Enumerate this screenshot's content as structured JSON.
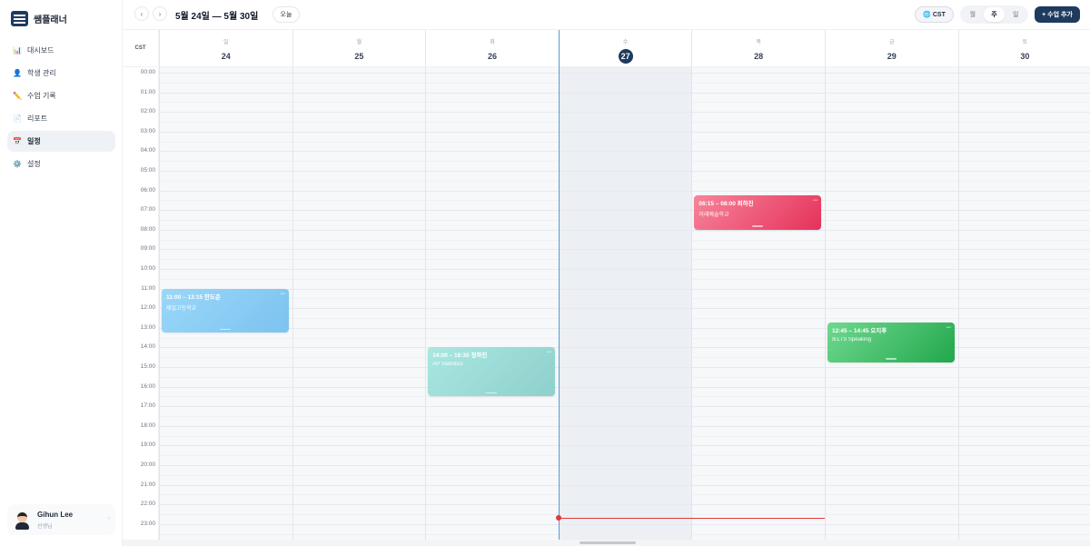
{
  "app": {
    "name": "쌤플래너"
  },
  "sidebar": {
    "items": [
      {
        "label": "대시보드",
        "icon": "📊",
        "icon_name": "bar-chart-icon",
        "active": false
      },
      {
        "label": "학생 관리",
        "icon": "👤",
        "icon_name": "person-icon",
        "active": false
      },
      {
        "label": "수업 기록",
        "icon": "✏️",
        "icon_name": "pencil-icon",
        "active": false
      },
      {
        "label": "리포트",
        "icon": "📄",
        "icon_name": "document-icon",
        "active": false
      },
      {
        "label": "일정",
        "icon": "📅",
        "icon_name": "calendar-icon",
        "active": true
      },
      {
        "label": "설정",
        "icon": "⚙️",
        "icon_name": "gear-icon",
        "active": false
      }
    ],
    "user": {
      "name": "Gihun Lee",
      "role": "선생님"
    }
  },
  "toolbar": {
    "prev_label": "‹",
    "next_label": "›",
    "range": "5월 24일 — 5월 30일",
    "today_label": "오늘",
    "timezone": "CST",
    "views": [
      "월",
      "주",
      "일"
    ],
    "active_view": 1,
    "add_label": "+ 수업 추가"
  },
  "calendar": {
    "timezone_label": "CST",
    "days": [
      {
        "weekday": "일",
        "date": "24",
        "today": false
      },
      {
        "weekday": "월",
        "date": "25",
        "today": false
      },
      {
        "weekday": "화",
        "date": "26",
        "today": false
      },
      {
        "weekday": "수",
        "date": "27",
        "today": true
      },
      {
        "weekday": "목",
        "date": "28",
        "today": false
      },
      {
        "weekday": "금",
        "date": "29",
        "today": false
      },
      {
        "weekday": "토",
        "date": "30",
        "today": false
      }
    ],
    "hours": [
      "00:00",
      "01:00",
      "02:00",
      "03:00",
      "04:00",
      "05:00",
      "06:00",
      "07:00",
      "08:00",
      "09:00",
      "10:00",
      "11:00",
      "12:00",
      "13:00",
      "14:00",
      "15:00",
      "16:00",
      "17:00",
      "18:00",
      "19:00",
      "20:00",
      "21:00",
      "22:00",
      "23:00"
    ],
    "now": {
      "day": 3,
      "time": "22:40"
    },
    "events": [
      {
        "day": 0,
        "start": "11:00",
        "end": "13:15",
        "time_label": "11:00 – 13:15 한도준",
        "subtitle": "제일고등학교",
        "color": "sky"
      },
      {
        "day": 2,
        "start": "14:00",
        "end": "16:30",
        "time_label": "14:00 – 16:30 정하진",
        "subtitle": "AP Statistics",
        "color": "teal"
      },
      {
        "day": 4,
        "start": "06:15",
        "end": "08:00",
        "time_label": "06:15 – 08:00 최하진",
        "subtitle": "미래예술학교",
        "color": "pink"
      },
      {
        "day": 5,
        "start": "12:45",
        "end": "14:45",
        "time_label": "12:45 – 14:45 오지후",
        "subtitle": "IELTS Speaking",
        "color": "green"
      }
    ]
  }
}
